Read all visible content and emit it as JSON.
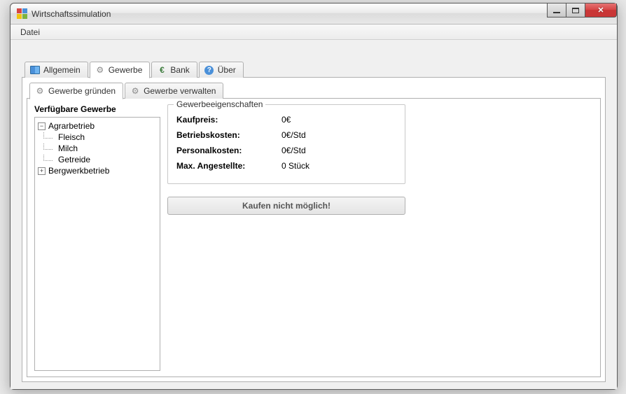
{
  "window": {
    "title": "Wirtschaftssimulation"
  },
  "menubar": {
    "file": "Datei"
  },
  "tabs": {
    "allgemein": "Allgemein",
    "gewerbe": "Gewerbe",
    "bank": "Bank",
    "ueber": "Über"
  },
  "subtabs": {
    "gruenden": "Gewerbe gründen",
    "verwalten": "Gewerbe verwalten"
  },
  "tree": {
    "heading": "Verfügbare Gewerbe",
    "agrar": "Agrarbetrieb",
    "agrar_children": {
      "fleisch": "Fleisch",
      "milch": "Milch",
      "getreide": "Getreide"
    },
    "bergwerk": "Bergwerkbetrieb"
  },
  "props": {
    "legend": "Gewerbeeigenschaften",
    "kaufpreis_label": "Kaufpreis:",
    "kaufpreis_value": "0€",
    "betriebskosten_label": "Betriebskosten:",
    "betriebskosten_value": "0€/Std",
    "personalkosten_label": "Personalkosten:",
    "personalkosten_value": "0€/Std",
    "max_label": "Max. Angestellte:",
    "max_value": "0 Stück"
  },
  "buy_button": "Kaufen nicht möglich!"
}
